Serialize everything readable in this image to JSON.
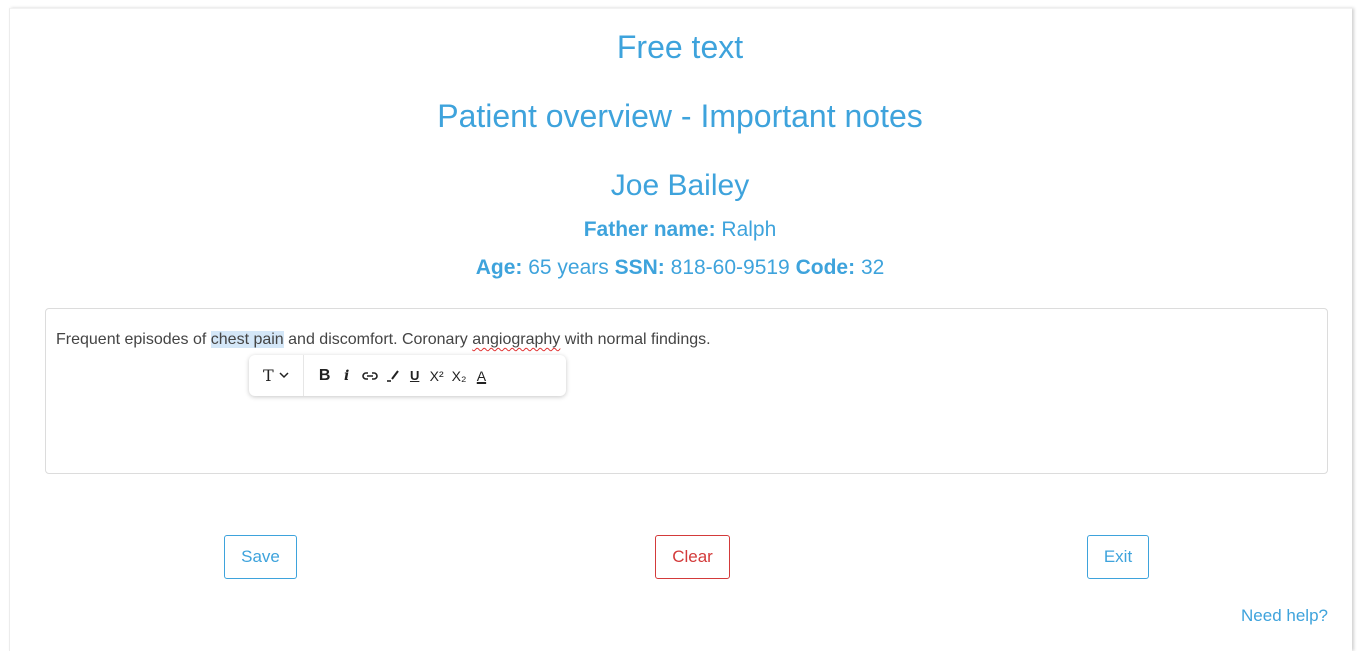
{
  "header": {
    "title": "Free text",
    "subtitle": "Patient overview - Important notes"
  },
  "patient": {
    "name": "Joe Bailey",
    "father_label": "Father name:",
    "father_value": "Ralph",
    "age_label": "Age:",
    "age_value": "65 years",
    "ssn_label": "SSN:",
    "ssn_value": "818-60-9519",
    "code_label": "Code:",
    "code_value": "32"
  },
  "editor": {
    "text_before": "Frequent episodes of ",
    "text_selected": "chest pain",
    "text_middle": " and discomfort. Coronary ",
    "text_misspelled": "angiography",
    "text_after": " with normal findings."
  },
  "toolbar": {
    "type_label": "T",
    "bold_label": "B",
    "italic_label": "i",
    "underline_label": "U",
    "superscript_label": "X²",
    "subscript_label": "X₂",
    "color_label": "A",
    "icons": [
      "type-icon",
      "chevron-down-icon",
      "bold-icon",
      "italic-icon",
      "link-icon",
      "highlight-icon",
      "underline-icon",
      "superscript-icon",
      "subscript-icon",
      "text-color-icon"
    ]
  },
  "actions": {
    "save_label": "Save",
    "clear_label": "Clear",
    "exit_label": "Exit"
  },
  "help_link": "Need help?",
  "colors": {
    "accent": "#3ea3dc",
    "danger": "#d33a3a",
    "selection": "#d4e7f8"
  }
}
